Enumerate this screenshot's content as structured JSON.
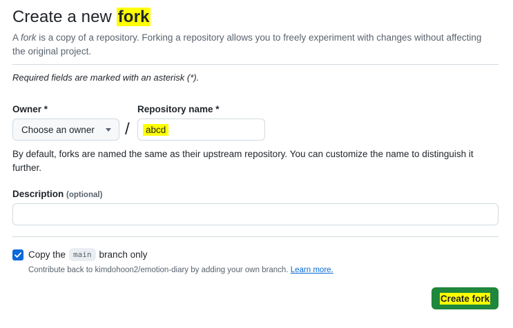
{
  "header": {
    "title_prefix": "Create a new ",
    "title_highlight": "fork"
  },
  "intro": {
    "prefix": "A ",
    "emph": "fork",
    "rest": " is a copy of a repository. Forking a repository allows you to freely experiment with changes without affecting the original project."
  },
  "required_note": "Required fields are marked with an asterisk (*).",
  "owner": {
    "label": "Owner *",
    "button_label": "Choose an owner"
  },
  "separator": "/",
  "repo": {
    "label": "Repository name *",
    "value": "abcd"
  },
  "repo_help": "By default, forks are named the same as their upstream repository. You can customize the name to distinguish it further.",
  "description": {
    "label": "Description",
    "optional": "(optional)",
    "value": ""
  },
  "copy_branch": {
    "checked": true,
    "label_prefix": "Copy the",
    "branch": "main",
    "label_suffix": "branch only",
    "contrib_text": "Contribute back to kimdohoon2/emotion-diary by adding your own branch.",
    "learn_more": "Learn more."
  },
  "submit": {
    "label": "Create fork"
  },
  "colors": {
    "primary_green": "#1f883d",
    "link_blue": "#0969da",
    "highlight": "#ffff00",
    "muted_text": "#59636e"
  }
}
